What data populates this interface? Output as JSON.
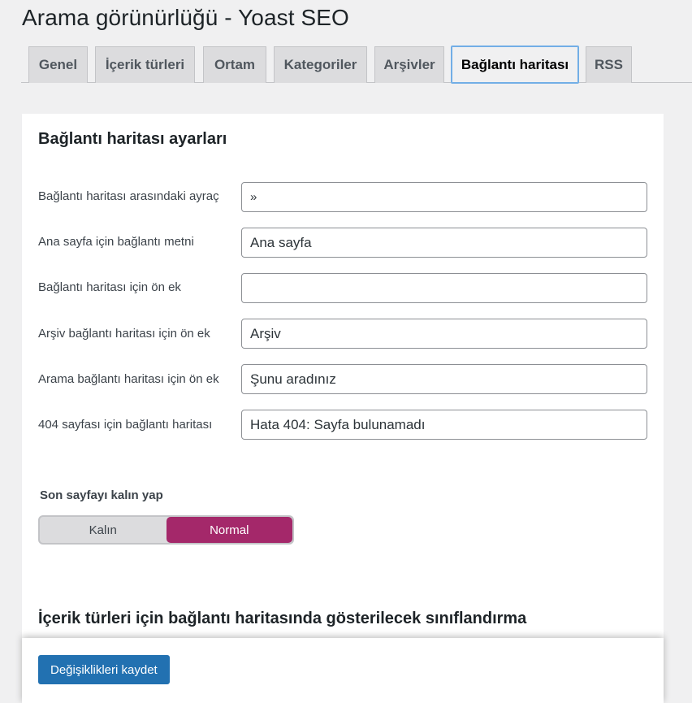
{
  "header": {
    "title": "Arama görünürlüğü - Yoast SEO"
  },
  "tabs": [
    {
      "label": "Genel",
      "active": false
    },
    {
      "label": "İçerik türleri",
      "active": false
    },
    {
      "label": "Ortam",
      "active": false
    },
    {
      "label": "Kategoriler",
      "active": false
    },
    {
      "label": "Arşivler",
      "active": false
    },
    {
      "label": "Bağlantı haritası",
      "active": true
    },
    {
      "label": "RSS",
      "active": false
    }
  ],
  "panel": {
    "heading": "Bağlantı haritası ayarları",
    "fields": [
      {
        "label": "Bağlantı haritası arasındaki ayraç",
        "value": "»"
      },
      {
        "label": "Ana sayfa için bağlantı metni",
        "value": "Ana sayfa"
      },
      {
        "label": "Bağlantı haritası için ön ek",
        "value": ""
      },
      {
        "label": "Arşiv bağlantı haritası için ön ek",
        "value": "Arşiv"
      },
      {
        "label": "Arama bağlantı haritası için ön ek",
        "value": "Şunu aradınız"
      },
      {
        "label": "404 sayfası için bağlantı haritası",
        "value": "Hata 404: Sayfa bulunamadı"
      }
    ],
    "bold_toggle": {
      "label": "Son sayfayı kalın yap",
      "options": [
        "Kalın",
        "Normal"
      ],
      "selected": "Normal"
    },
    "taxonomy_heading": "İçerik türleri için bağlantı haritasında gösterilecek sınıflandırma"
  },
  "footer": {
    "save_label": "Değişiklikleri kaydet"
  },
  "colors": {
    "accent": "#a4286a",
    "primary_button": "#2271b1",
    "active_tab_border": "#72aee6"
  }
}
